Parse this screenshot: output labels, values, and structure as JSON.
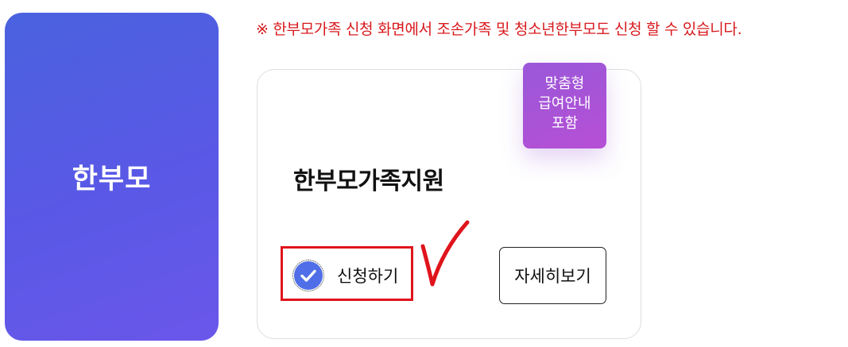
{
  "category": {
    "title": "한부모"
  },
  "notice": {
    "text": "※ 한부모가족 신청 화면에서 조손가족 및 청소년한부모도 신청 할 수 있습니다."
  },
  "service": {
    "badge_lines": [
      "맞춤형",
      "급여안내",
      "포함"
    ],
    "title": "한부모가족지원",
    "apply_label": "신청하기",
    "apply_checked": true,
    "detail_label": "자세히보기"
  },
  "colors": {
    "accent": "#4f6ee8",
    "notice": "#d8191d",
    "highlight": "#e0141c",
    "badge": "#b64fd6"
  },
  "icons": {
    "checkbox": "check-circle-icon",
    "annotation": "red-checkmark-annotation"
  }
}
